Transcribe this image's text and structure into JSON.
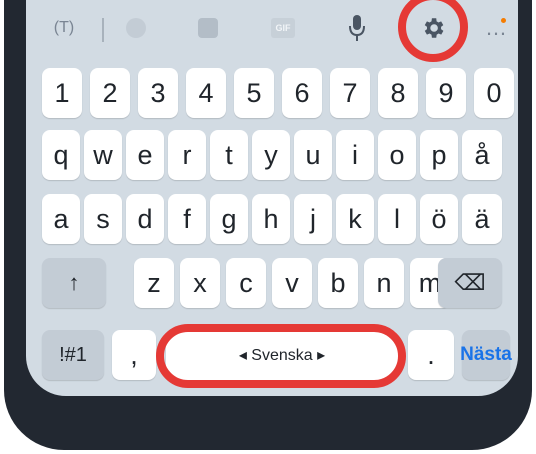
{
  "toolbar": {
    "translate_label": "(T)",
    "more_label": "…"
  },
  "keys": {
    "number_row": [
      "1",
      "2",
      "3",
      "4",
      "5",
      "6",
      "7",
      "8",
      "9",
      "0"
    ],
    "row1": [
      "q",
      "w",
      "e",
      "r",
      "t",
      "y",
      "u",
      "i",
      "o",
      "p",
      "å"
    ],
    "row2": [
      "a",
      "s",
      "d",
      "f",
      "g",
      "h",
      "j",
      "k",
      "l",
      "ö",
      "ä"
    ],
    "row3": [
      "z",
      "x",
      "c",
      "v",
      "b",
      "n",
      "m"
    ],
    "shift": "↑",
    "backspace": "⌫",
    "symbols": "!#1",
    "comma": ",",
    "space": "◂ Svenska ▸",
    "period": ".",
    "next": "Nästa"
  },
  "colors": {
    "highlight_ring": "#e53935",
    "next_key": "#1a73e8",
    "keyboard_bg": "#d2dbe3"
  }
}
